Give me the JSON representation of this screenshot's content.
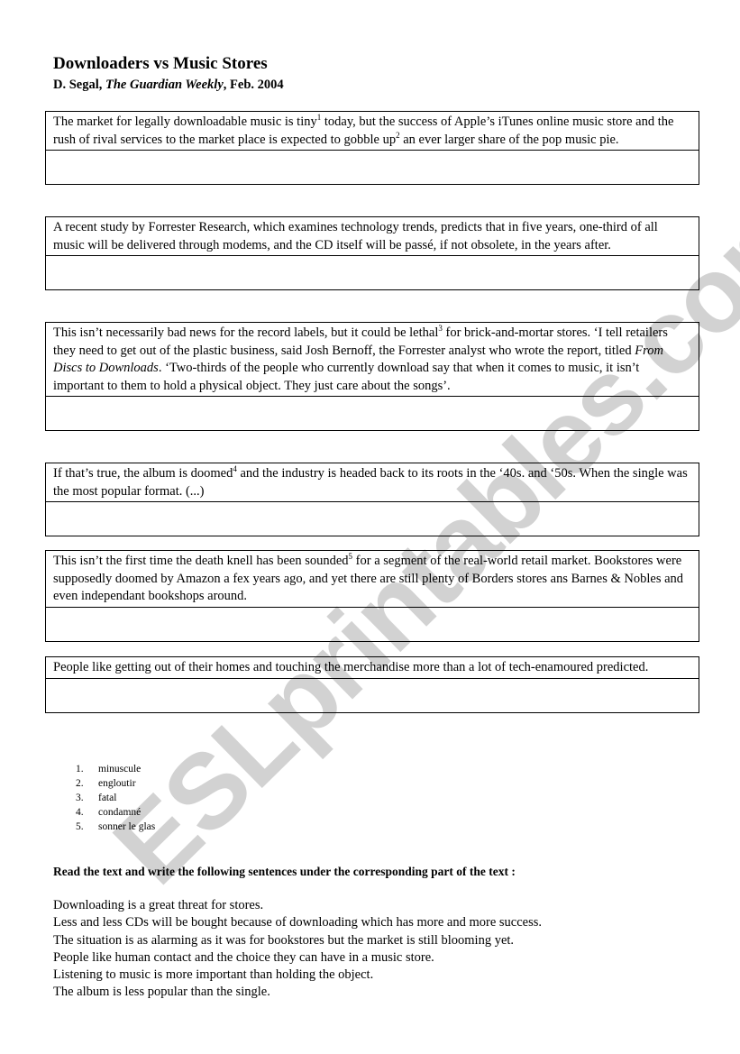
{
  "watermark": "ESLprintables.com",
  "header": {
    "title": "Downloaders vs Music Stores",
    "author": "D. Segal, ",
    "publication": "The Guardian Weekly",
    "date": ", Feb. 2004"
  },
  "passages": [
    {
      "parts": [
        {
          "t": "The market for legally downloadable music is tiny"
        },
        {
          "sup": "1"
        },
        {
          "t": " today, but the success of Apple’s iTunes online music store and the rush of rival services to the market place is expected to gobble up"
        },
        {
          "sup": "2"
        },
        {
          "t": " an ever larger share of the pop music pie."
        }
      ],
      "answer": ""
    },
    {
      "parts": [
        {
          "t": "A recent study by Forrester Research, which examines technology trends, predicts that in five years, one-third of all music will be delivered through modems, and the CD itself will be passé, if not obsolete, in the years after."
        }
      ],
      "answer": ""
    },
    {
      "parts": [
        {
          "t": "This isn’t necessarily bad news for the record labels, but it could be lethal"
        },
        {
          "sup": "3"
        },
        {
          "t": " for brick-and-mortar stores. ‘I tell retailers they need to get out of the plastic business, said Josh Bernoff, the Forrester analyst who wrote the report, titled "
        },
        {
          "i": "From Discs to Downloads"
        },
        {
          "t": ". ‘Two-thirds of the people who currently download say that when it comes to music, it isn’t important to them to hold a physical object. They just care about the songs’."
        }
      ],
      "answer": ""
    },
    {
      "parts": [
        {
          "t": "If that’s true, the album is doomed"
        },
        {
          "sup": "4"
        },
        {
          "t": " and the industry is headed back to its roots in the ‘40s. and ‘50s. When the single was the most popular format. (...)"
        }
      ],
      "answer": ""
    },
    {
      "parts": [
        {
          "t": "This isn’t the first time the death knell has been sounded"
        },
        {
          "sup": "5"
        },
        {
          "t": " for a segment of the real-world retail market. Bookstores were supposedly doomed by Amazon a fex years ago, and yet there are still plenty of Borders stores ans Barnes & Nobles and even independant bookshops around."
        }
      ],
      "answer": ""
    },
    {
      "parts": [
        {
          "t": "People like getting out of their homes and touching the merchandise more than a lot of tech-enamoured predicted."
        }
      ],
      "answer": ""
    }
  ],
  "glossary": [
    {
      "num": "1.",
      "term": "minuscule"
    },
    {
      "num": "2.",
      "term": "engloutir"
    },
    {
      "num": "3.",
      "term": "fatal"
    },
    {
      "num": "4.",
      "term": "condamné"
    },
    {
      "num": "5.",
      "term": "sonner le glas"
    }
  ],
  "instruction": "Read the text and write the following sentences under the corresponding part of the text :",
  "sentences": [
    "Downloading is a great threat for stores.",
    "Less and less CDs will be bought because of downloading which has more and more success.",
    "The situation is as alarming as it was for bookstores but the market is still blooming yet.",
    "People like human contact and the choice they can have in a music store.",
    "Listening to music is more important than holding the object.",
    "The album is less popular than the single."
  ]
}
